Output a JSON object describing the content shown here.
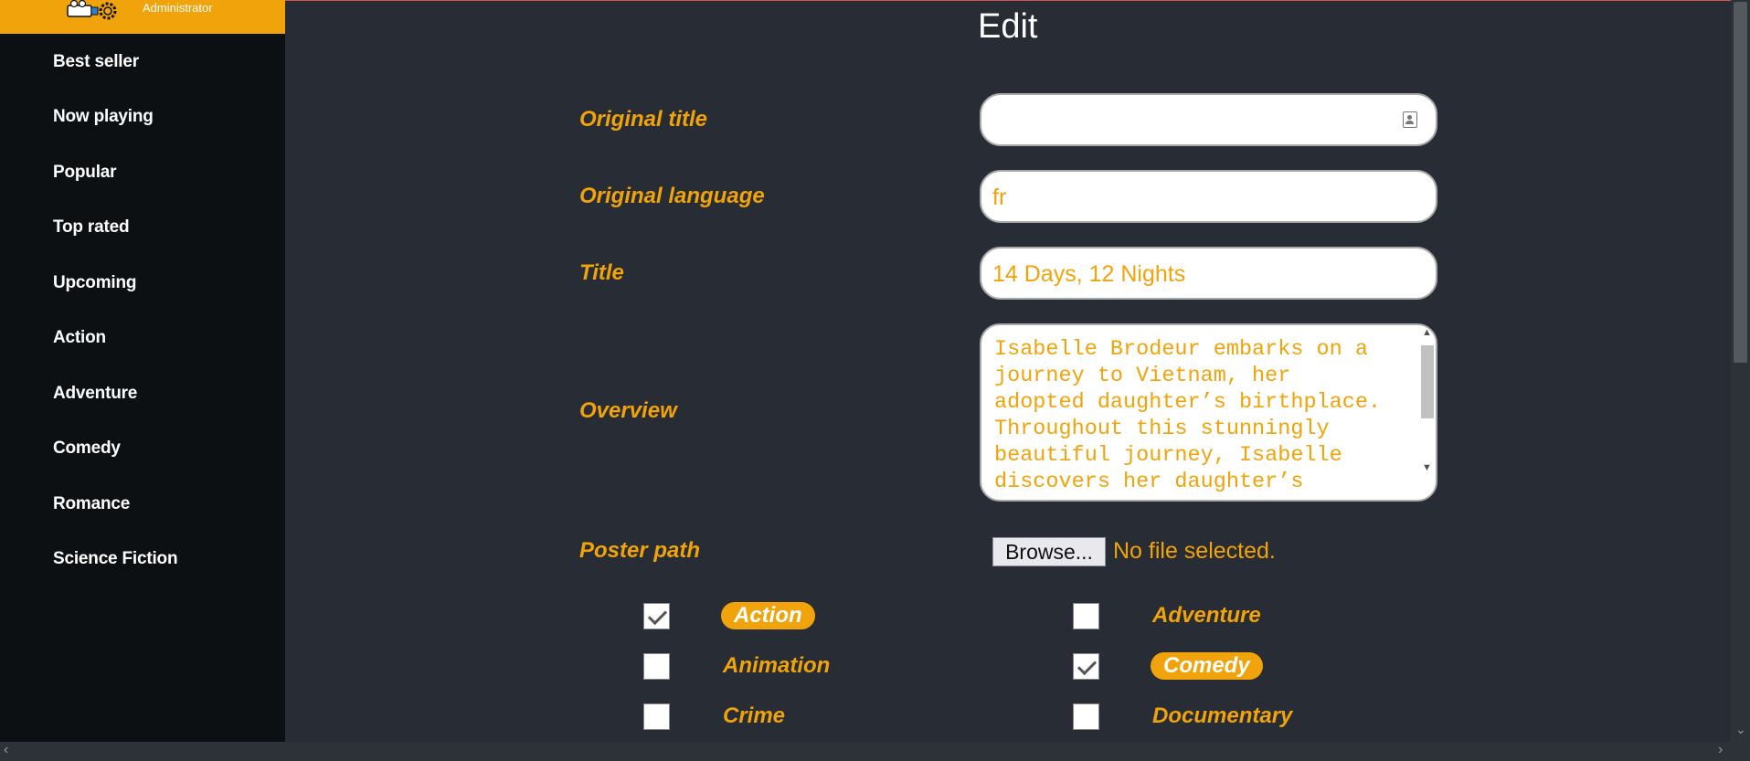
{
  "brand": {
    "role": "Administrator"
  },
  "sidebar": {
    "items": [
      {
        "label": "Best seller"
      },
      {
        "label": "Now playing"
      },
      {
        "label": "Popular"
      },
      {
        "label": "Top rated"
      },
      {
        "label": "Upcoming"
      },
      {
        "label": "Action"
      },
      {
        "label": "Adventure"
      },
      {
        "label": "Comedy"
      },
      {
        "label": "Romance"
      },
      {
        "label": "Science Fiction"
      }
    ]
  },
  "page": {
    "title": "Edit"
  },
  "form": {
    "original_title": {
      "label": "Original title",
      "value": ""
    },
    "original_language": {
      "label": "Original language",
      "value": "fr"
    },
    "title": {
      "label": "Title",
      "value": "14 Days, 12 Nights"
    },
    "overview": {
      "label": "Overview",
      "value": "Isabelle Brodeur embarks on a\njourney to Vietnam, her\nadopted daughter’s birthplace.\nThroughout this stunningly\nbeautiful journey, Isabelle\ndiscovers her daughter’s"
    },
    "poster_path": {
      "label": "Poster path",
      "button": "Browse...",
      "status": "No file selected."
    }
  },
  "genres": [
    {
      "label": "Action",
      "checked": true
    },
    {
      "label": "Adventure",
      "checked": false
    },
    {
      "label": "Animation",
      "checked": false
    },
    {
      "label": "Comedy",
      "checked": true
    },
    {
      "label": "Crime",
      "checked": false
    },
    {
      "label": "Documentary",
      "checked": false
    }
  ],
  "colors": {
    "accent": "#f0a30a",
    "background": "#282c34",
    "sidebar": "#0d1013"
  },
  "icons": {
    "logo": "film-camera-gear-icon",
    "original_title_field": "contact-card-icon"
  }
}
